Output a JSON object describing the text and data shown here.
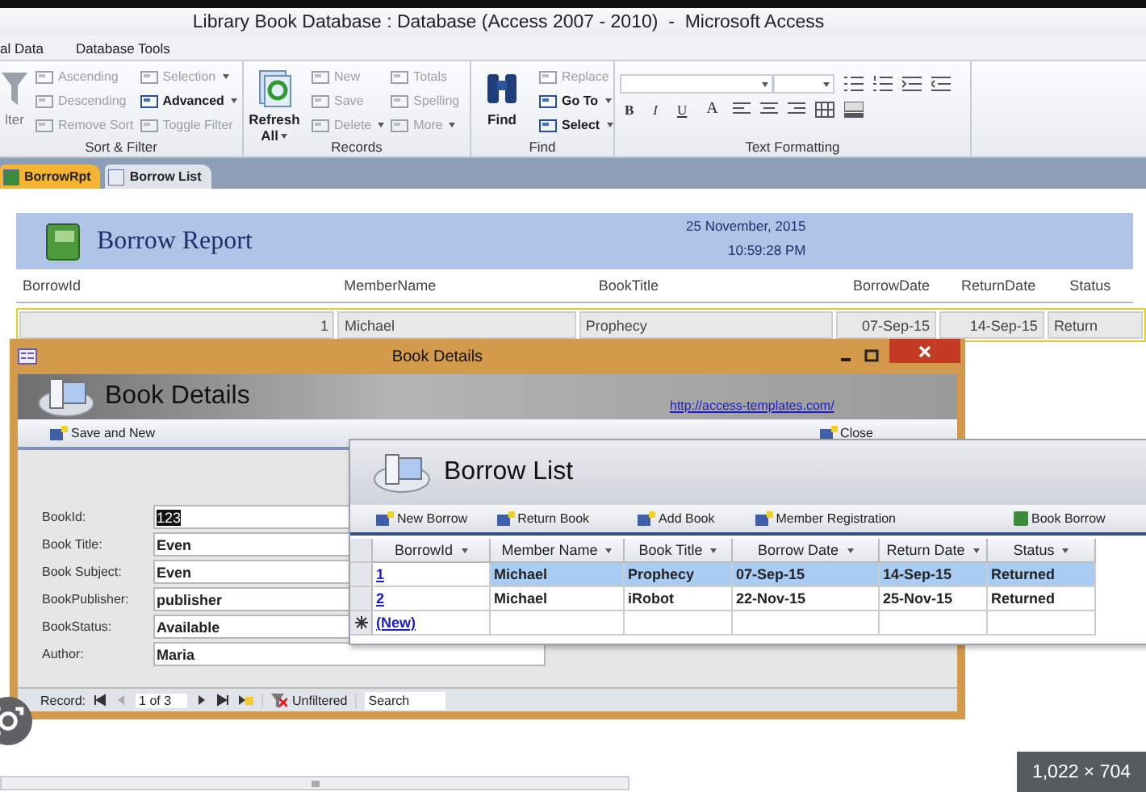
{
  "window": {
    "title": "Library Book Database : Database (Access 2007 - 2010)  -  Microsoft Access"
  },
  "ribbon_tabs": [
    "al Data",
    "Database Tools"
  ],
  "ribbon_groups": [
    {
      "label": "Sort & Filter",
      "kind": "commands",
      "columns": [
        [
          {
            "label": "lter",
            "kind": "large",
            "disabled": true,
            "dropdown": false
          }
        ],
        [
          {
            "label": "Ascending",
            "kind": "small",
            "disabled": true,
            "dropdown": false
          },
          {
            "label": "Descending",
            "kind": "small",
            "disabled": true,
            "dropdown": false
          },
          {
            "label": "Remove Sort",
            "kind": "small",
            "disabled": true,
            "dropdown": false
          }
        ],
        [
          {
            "label": "Selection",
            "kind": "small",
            "disabled": true,
            "dropdown": true
          },
          {
            "label": "Advanced",
            "kind": "small",
            "disabled": false,
            "dropdown": true
          },
          {
            "label": "Toggle Filter",
            "kind": "small",
            "disabled": true,
            "dropdown": false
          }
        ]
      ]
    },
    {
      "label": "Records",
      "kind": "commands",
      "columns": [
        [
          {
            "label": "Refresh All",
            "kind": "large",
            "disabled": false,
            "dropdown": true
          }
        ],
        [
          {
            "label": "New",
            "kind": "small",
            "disabled": true,
            "dropdown": false
          },
          {
            "label": "Save",
            "kind": "small",
            "disabled": true,
            "dropdown": false
          },
          {
            "label": "Delete",
            "kind": "small",
            "disabled": true,
            "dropdown": true
          }
        ],
        [
          {
            "label": "Totals",
            "kind": "small",
            "disabled": true,
            "dropdown": false
          },
          {
            "label": "Spelling",
            "kind": "small",
            "disabled": true,
            "dropdown": false
          },
          {
            "label": "More",
            "kind": "small",
            "disabled": true,
            "dropdown": true
          }
        ]
      ]
    },
    {
      "label": "Find",
      "kind": "commands",
      "columns": [
        [
          {
            "label": "Find",
            "kind": "large",
            "disabled": false,
            "dropdown": false
          }
        ],
        [
          {
            "label": "Replace",
            "kind": "small",
            "disabled": true,
            "dropdown": false
          },
          {
            "label": "Go To",
            "kind": "small",
            "disabled": false,
            "dropdown": true
          },
          {
            "label": "Select",
            "kind": "small",
            "disabled": false,
            "dropdown": true
          }
        ]
      ]
    },
    {
      "label": "Text Formatting",
      "kind": "formatting",
      "format_buttons": [
        "B",
        "I",
        "U",
        "A"
      ]
    }
  ],
  "document_tabs": [
    {
      "label": "BorrowRpt",
      "selected": true
    },
    {
      "label": "Borrow List",
      "selected": false
    }
  ],
  "report": {
    "title": "Borrow Report",
    "date": "25 November, 2015",
    "time": "10:59:28 PM",
    "columns": [
      "BorrowId",
      "MemberName",
      "BookTitle",
      "BorrowDate",
      "ReturnDate",
      "Status"
    ],
    "rows": [
      [
        "1",
        "Michael",
        "Prophecy",
        "07-Sep-15",
        "14-Sep-15",
        "Return"
      ]
    ]
  },
  "book_details": {
    "title": "Book Details",
    "header": "Book Details",
    "link": "http://access-templates.com/",
    "toolbar": [
      "Save and New",
      "Close"
    ],
    "fields": [
      {
        "label": "BookId:",
        "value": "123",
        "highlighted": true
      },
      {
        "label": "Book Title:",
        "value": "Even",
        "highlighted": false
      },
      {
        "label": "Book Subject:",
        "value": "Even",
        "highlighted": false
      },
      {
        "label": "BookPublisher:",
        "value": "publisher",
        "highlighted": false
      },
      {
        "label": "BookStatus:",
        "value": "Available",
        "highlighted": false
      },
      {
        "label": "Author:",
        "value": "Maria",
        "highlighted": false
      }
    ],
    "navigator": {
      "label": "Record:",
      "position": "1 of 3",
      "filter": "Unfiltered",
      "search_placeholder": "Search"
    }
  },
  "borrow_list": {
    "title": "Borrow List",
    "toolbar": [
      {
        "label": "New Borrow",
        "kind": "form"
      },
      {
        "label": "Return Book",
        "kind": "form"
      },
      {
        "label": "Add Book",
        "kind": "form"
      },
      {
        "label": "Member Registration",
        "kind": "form"
      },
      {
        "label": "Book Borrow",
        "kind": "report"
      }
    ],
    "columns": [
      "BorrowId",
      "Member Name",
      "Book Title",
      "Borrow Date",
      "Return Date",
      "Status"
    ],
    "rows": [
      {
        "cells": [
          "1",
          "Michael",
          "Prophecy",
          "07-Sep-15",
          "14-Sep-15",
          "Returned"
        ],
        "selected": true
      },
      {
        "cells": [
          "2",
          "Michael",
          "iRobot",
          "22-Nov-15",
          "25-Nov-15",
          "Returned"
        ],
        "selected": false
      }
    ],
    "new_row": "(New)"
  },
  "image_size": "1,022 × 704"
}
